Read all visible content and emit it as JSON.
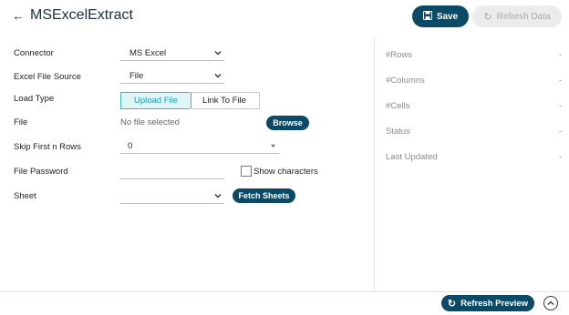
{
  "header": {
    "title": "MSExcelExtract",
    "save_label": "Save",
    "refresh_label": "Refresh Data"
  },
  "form": {
    "connector": {
      "label": "Connector",
      "value": "MS Excel"
    },
    "excel_file_source": {
      "label": "Excel File Source",
      "value": "File"
    },
    "load_type": {
      "label": "Load Type",
      "options": [
        "Upload File",
        "Link To File"
      ],
      "selected": "Upload File"
    },
    "file": {
      "label": "File",
      "value": "No file selected",
      "browse_label": "Browse"
    },
    "skip_rows": {
      "label": "Skip First n Rows",
      "value": "0"
    },
    "file_password": {
      "label": "File Password",
      "value": "",
      "show_characters_label": "Show characters",
      "show_characters_checked": false
    },
    "sheet": {
      "label": "Sheet",
      "value": "",
      "fetch_label": "Fetch Sheets"
    }
  },
  "stats": [
    {
      "label": "#Rows",
      "value": "-"
    },
    {
      "label": "#Columns",
      "value": "-"
    },
    {
      "label": "#Cells",
      "value": "-"
    },
    {
      "label": "Status",
      "value": "-"
    },
    {
      "label": "Last Updated",
      "value": "-"
    }
  ],
  "footer": {
    "refresh_preview_label": "Refresh Preview"
  }
}
